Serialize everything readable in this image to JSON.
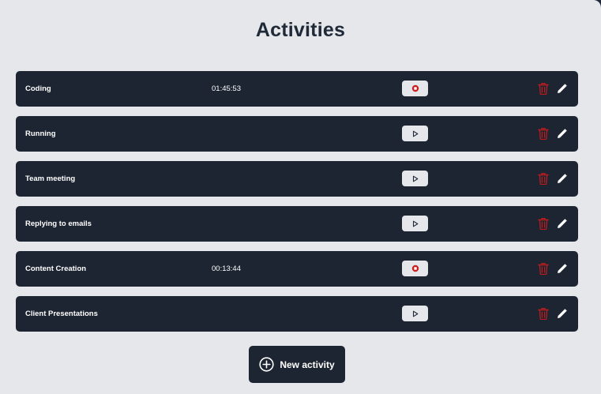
{
  "page": {
    "title": "Activities"
  },
  "activities": [
    {
      "name": "Coding",
      "time": "01:45:53",
      "state": "running",
      "control_icon": "stop-icon"
    },
    {
      "name": "Running",
      "time": "",
      "state": "stopped",
      "control_icon": "play-icon"
    },
    {
      "name": "Team meeting",
      "time": "",
      "state": "stopped",
      "control_icon": "play-icon"
    },
    {
      "name": "Replying to emails",
      "time": "",
      "state": "stopped",
      "control_icon": "play-icon"
    },
    {
      "name": "Content Creation",
      "time": "00:13:44",
      "state": "running",
      "control_icon": "stop-icon"
    },
    {
      "name": "Client Presentations",
      "time": "",
      "state": "stopped",
      "control_icon": "play-icon"
    }
  ],
  "row_icons": {
    "delete": "trash-icon",
    "edit": "pencil-icon"
  },
  "new_activity_button": {
    "label": "New activity",
    "icon": "plus-circle-icon"
  },
  "colors": {
    "background": "#e5e7eb",
    "row_background": "#1e2532",
    "row_text": "#ffffff",
    "title_text": "#1f2937",
    "delete_red": "#b91c1c",
    "stop_red": "#c81e1e",
    "control_bg": "#e5e7eb"
  }
}
